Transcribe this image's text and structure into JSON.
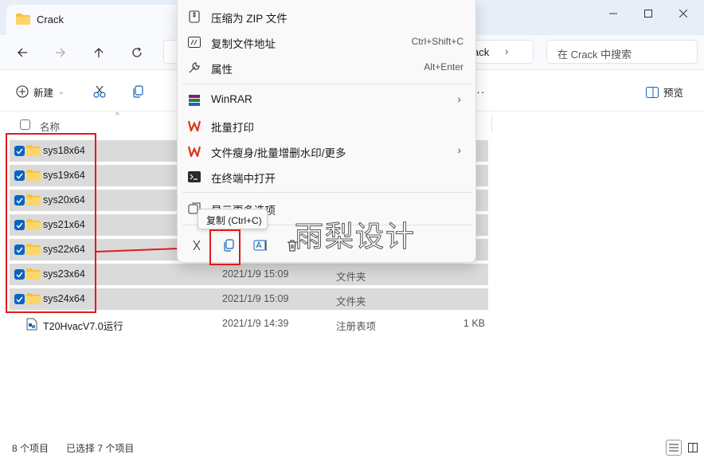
{
  "window": {
    "tab_title": "Crack"
  },
  "address": {
    "breadcrumb": "ack",
    "search_placeholder": "在 Crack 中搜索"
  },
  "toolbar": {
    "new_label": "新建",
    "preview_label": "预览"
  },
  "list": {
    "header_name": "名称",
    "rows": [
      {
        "name": "sys18x64",
        "date": "",
        "type": "",
        "size": "",
        "selected": true
      },
      {
        "name": "sys19x64",
        "date": "",
        "type": "",
        "size": "",
        "selected": true
      },
      {
        "name": "sys20x64",
        "date": "",
        "type": "",
        "size": "",
        "selected": true
      },
      {
        "name": "sys21x64",
        "date": "",
        "type": "",
        "size": "",
        "selected": true
      },
      {
        "name": "sys22x64",
        "date": "",
        "type": "",
        "size": "",
        "selected": true
      },
      {
        "name": "sys23x64",
        "date": "2021/1/9 15:09",
        "type": "文件夹",
        "size": "",
        "selected": true
      },
      {
        "name": "sys24x64",
        "date": "2021/1/9 15:09",
        "type": "文件夹",
        "size": "",
        "selected": true
      },
      {
        "name": "T20HvacV7.0运行",
        "date": "2021/1/9 14:39",
        "type": "注册表项",
        "size": "1 KB",
        "selected": false
      }
    ]
  },
  "context_menu": {
    "items": [
      {
        "label": "压缩为 ZIP 文件",
        "shortcut": "",
        "icon": "zip-icon"
      },
      {
        "label": "复制文件地址",
        "shortcut": "Ctrl+Shift+C",
        "icon": "path-icon"
      },
      {
        "label": "属性",
        "shortcut": "Alt+Enter",
        "icon": "wrench-icon"
      },
      {
        "label": "WinRAR",
        "shortcut": "",
        "icon": "winrar-icon"
      },
      {
        "label": "批量打印",
        "shortcut": "",
        "icon": "wps-icon"
      },
      {
        "label": "文件瘦身/批量增删水印/更多",
        "shortcut": "",
        "icon": "wps-icon"
      },
      {
        "label": "在终端中打开",
        "shortcut": "",
        "icon": "terminal-icon"
      },
      {
        "label": "显示更多选项",
        "shortcut": "",
        "icon": "more-options-icon"
      }
    ],
    "tooltip": "复制 (Ctrl+C)"
  },
  "watermark": "雨梨设计",
  "status": {
    "item_count": "8 个项目",
    "selected_count": "已选择 7 个项目"
  },
  "colors": {
    "accent": "#0b64c0",
    "highlight_red": "#e11b1b",
    "folder_yellow": "#f8c33c",
    "selection_gray": "#dadada"
  }
}
